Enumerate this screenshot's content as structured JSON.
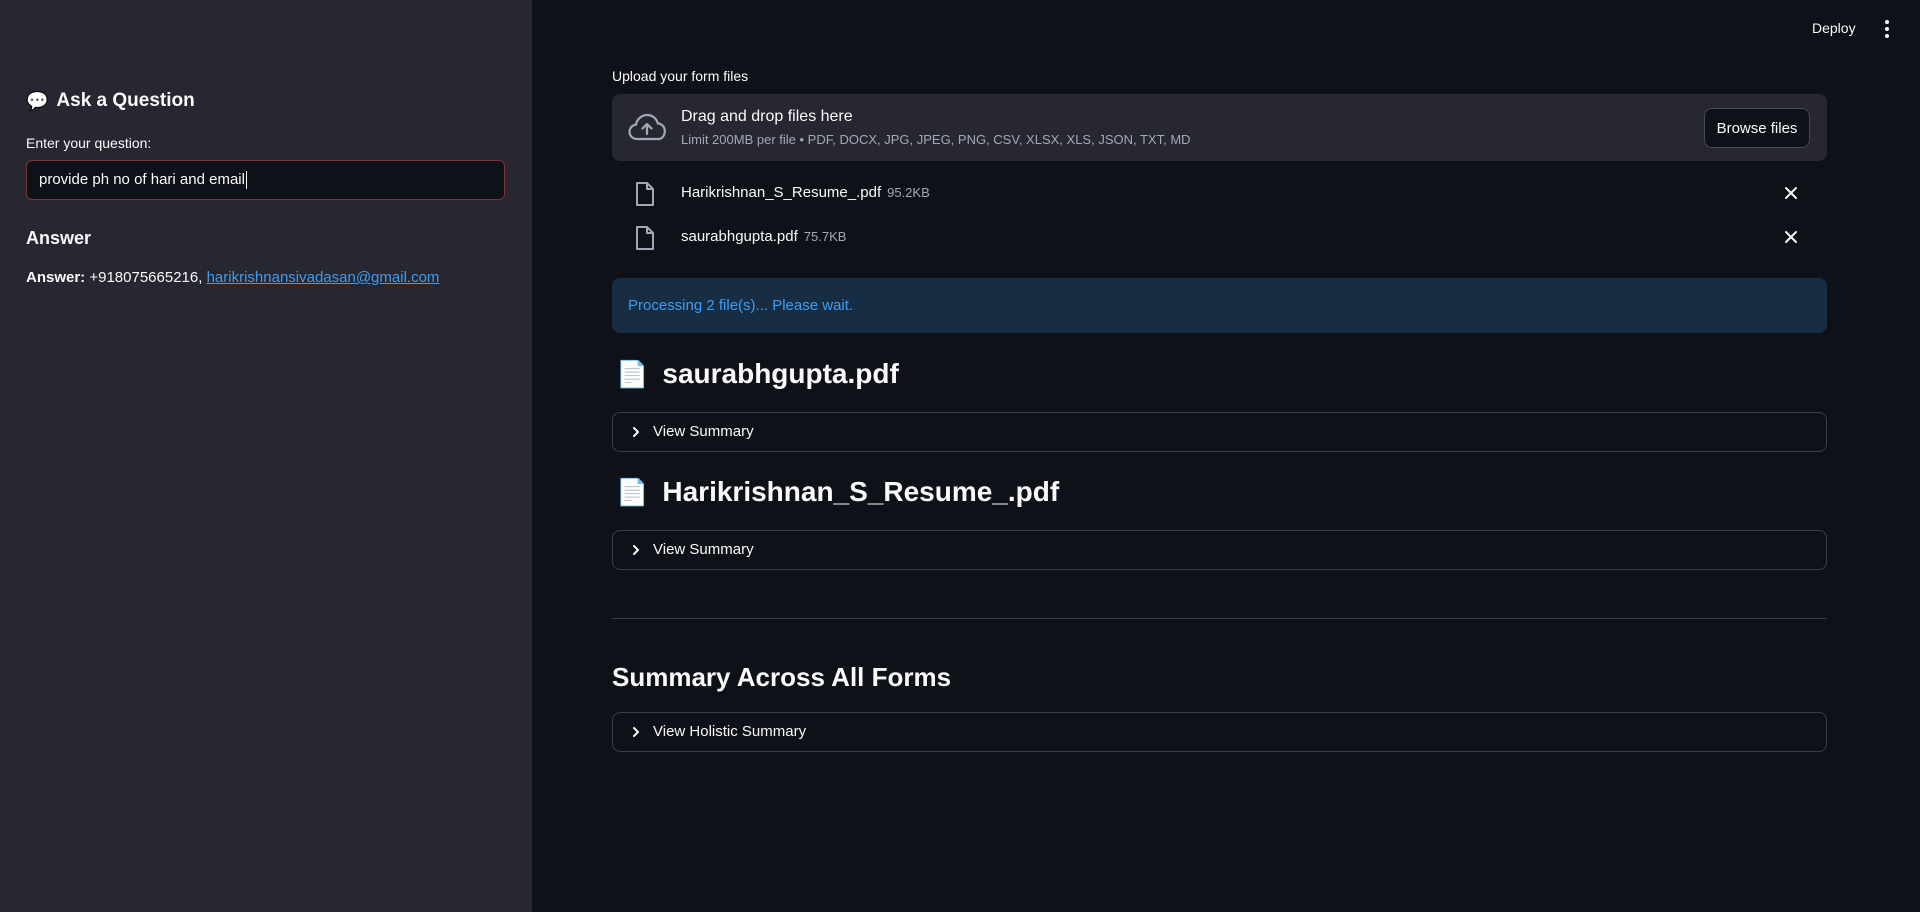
{
  "header": {
    "deploy_label": "Deploy"
  },
  "sidebar": {
    "title_icon": "💬",
    "title": "Ask a Question",
    "question_label": "Enter your question:",
    "question_value": "provide ph no of hari and email",
    "answer_heading": "Answer",
    "answer_prefix": "Answer:",
    "answer_phone": "+918075665216,",
    "answer_email": "harikrishnansivadasan@gmail.com"
  },
  "uploader": {
    "label": "Upload your form files",
    "drop_text": "Drag and drop files here",
    "limit_text": "Limit 200MB per file • PDF, DOCX, JPG, JPEG, PNG, CSV, XLSX, XLS, JSON, TXT, MD",
    "browse_label": "Browse files",
    "files": [
      {
        "name": "Harikrishnan_S_Resume_.pdf",
        "size": "95.2KB"
      },
      {
        "name": "saurabhgupta.pdf",
        "size": "75.7KB"
      }
    ]
  },
  "status": {
    "message": "Processing 2 file(s)... Please wait."
  },
  "results": [
    {
      "icon": "📄",
      "filename": "saurabhgupta.pdf",
      "expander_label": "View Summary"
    },
    {
      "icon": "📄",
      "filename": "Harikrishnan_S_Resume_.pdf",
      "expander_label": "View Summary"
    }
  ],
  "overall": {
    "title": "Summary Across All Forms",
    "expander_label": "View Holistic Summary"
  },
  "colors": {
    "background": "#0e1117",
    "sidebar": "#262730",
    "link": "#3d9df3",
    "info_bg": "#172d43",
    "input_border": "#7d353b"
  }
}
